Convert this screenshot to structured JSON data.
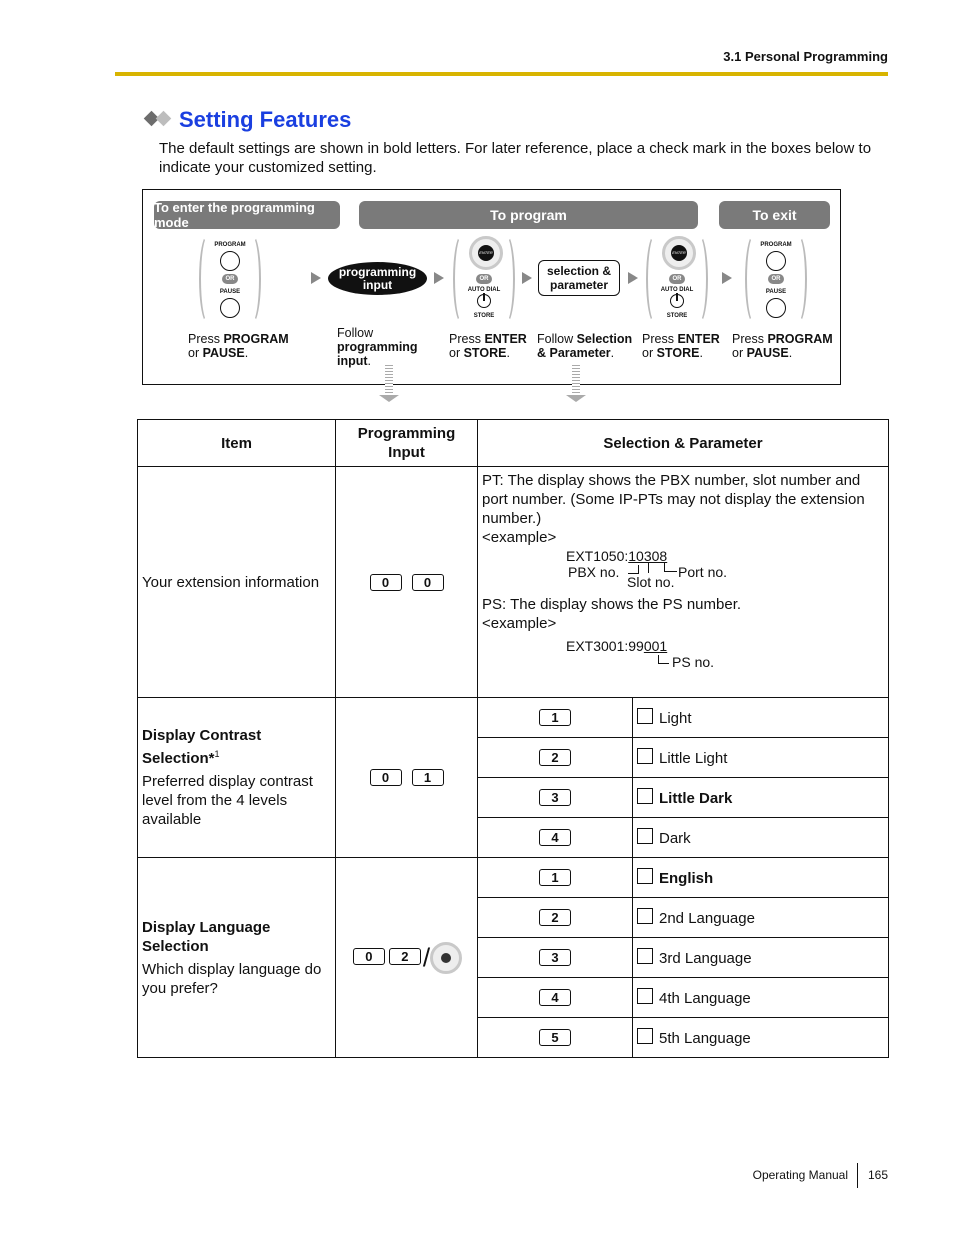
{
  "header": {
    "section": "3.1 Personal Programming",
    "accent_color": "#d8b400"
  },
  "title": "Setting Features",
  "title_color": "#1a3fe0",
  "intro": "The default settings are shown in bold letters. For later reference, place a check mark in the boxes below to indicate your customized setting.",
  "flow": {
    "enter_mode": "To enter the programming mode",
    "to_program": "To program",
    "to_exit": "To exit",
    "program_label": "PROGRAM",
    "pause_label": "PAUSE",
    "or_label": "OR",
    "auto_dial_label": "AUTO DIAL",
    "store_label": "STORE",
    "enter_label": "ENTER",
    "programming_input": "programming input",
    "selection_parameter": "selection & parameter",
    "captions": {
      "step1_a": "Press ",
      "step1_b": "PROGRAM",
      "step1_c": "or ",
      "step1_d": "PAUSE",
      "step1_e": ".",
      "step2_a": "Follow",
      "step2_b": "programming",
      "step2_c": "input",
      "step2_d": ".",
      "step3_a": "Press ",
      "step3_b": "ENTER",
      "step3_c": "or ",
      "step3_d": "STORE",
      "step3_e": ".",
      "step4_a": "Follow ",
      "step4_b": "Selection",
      "step4_c": "& Parameter",
      "step4_d": ".",
      "step5_a": "Press ",
      "step5_b": "ENTER",
      "step5_c": "or ",
      "step5_d": "STORE",
      "step5_e": ".",
      "step6_a": "Press ",
      "step6_b": "PROGRAM",
      "step6_c": "or ",
      "step6_d": "PAUSE",
      "step6_e": "."
    }
  },
  "table": {
    "headers": [
      "Item",
      "Programming Input",
      "Selection & Parameter"
    ],
    "row1": {
      "item": "Your extension information",
      "keys": [
        "0",
        "0"
      ],
      "pt_text": "PT: The display shows the PBX number, slot number and port number. (Some IP-PTs may not display the extension number.)",
      "example": "<example>",
      "pt_example_prefix": "EXT1050:",
      "pt_example_value": "10308",
      "pbx_no": "PBX no.",
      "slot_no": "Slot no.",
      "port_no": "Port no.",
      "ps_text": "PS: The display shows the PS number.",
      "ps_example_prefix": "EXT3001:99",
      "ps_example_value": "001",
      "ps_no": "PS no."
    },
    "row2": {
      "item_title": "Display Contrast Selection*",
      "footnote": "1",
      "item_desc": "Preferred display contrast level from the 4 levels available",
      "keys": [
        "0",
        "1"
      ],
      "options": [
        {
          "key": "1",
          "label": "Light",
          "default": false
        },
        {
          "key": "2",
          "label": "Little Light",
          "default": false
        },
        {
          "key": "3",
          "label": "Little Dark",
          "default": true
        },
        {
          "key": "4",
          "label": "Dark",
          "default": false
        }
      ]
    },
    "row3": {
      "item_title": "Display Language Selection",
      "item_desc": "Which display language do you prefer?",
      "keys": [
        "0",
        "2"
      ],
      "slash": "/",
      "options": [
        {
          "key": "1",
          "label": "English",
          "default": true
        },
        {
          "key": "2",
          "label": "2nd Language",
          "default": false
        },
        {
          "key": "3",
          "label": "3rd Language",
          "default": false
        },
        {
          "key": "4",
          "label": "4th Language",
          "default": false
        },
        {
          "key": "5",
          "label": "5th Language",
          "default": false
        }
      ]
    }
  },
  "footer": {
    "doc": "Operating Manual",
    "page": "165"
  }
}
